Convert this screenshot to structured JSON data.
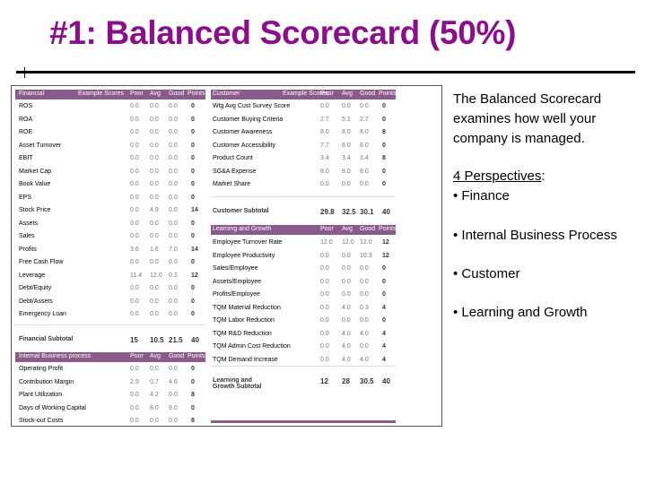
{
  "title": "#1: Balanced Scorecard (50%)",
  "colors": {
    "title": "#8b0e8b",
    "table_header": "#8a5a8a"
  },
  "scorecard": {
    "financial": {
      "header": [
        "Financial",
        "Example Scores",
        "Poor",
        "Avg",
        "Good",
        "Points"
      ],
      "rows": [
        [
          "ROS",
          "0.0",
          "0.0",
          "0.0",
          "0"
        ],
        [
          "ROA",
          "0.0",
          "0.0",
          "0.0",
          "0"
        ],
        [
          "ROE",
          "0.0",
          "0.0",
          "0.0",
          "0"
        ],
        [
          "Asset Turnover",
          "0.0",
          "0.0",
          "0.0",
          "0"
        ],
        [
          "EBIT",
          "0.0",
          "0.0",
          "0.0",
          "0"
        ],
        [
          "Market Cap",
          "0.0",
          "0.0",
          "0.0",
          "0"
        ],
        [
          "Book Value",
          "0.0",
          "0.0",
          "0.0",
          "0"
        ],
        [
          "EPS",
          "0.0",
          "0.0",
          "0.0",
          "0"
        ],
        [
          "Stock Price",
          "0.0",
          "4.9",
          "0.0",
          "14"
        ],
        [
          "Assets",
          "0.0",
          "0.0",
          "0.0",
          "0"
        ],
        [
          "Sales",
          "0.0",
          "0.0",
          "0.0",
          "0"
        ],
        [
          "Profits",
          "3.6",
          "1.6",
          "7.0",
          "14"
        ],
        [
          "Free Cash Flow",
          "0.0",
          "0.0",
          "0.0",
          "0"
        ],
        [
          "Leverage",
          "11.4",
          "12.0",
          "0.2",
          "12"
        ],
        [
          "Debt/Equity",
          "0.0",
          "0.0",
          "0.0",
          "0"
        ],
        [
          "Debt/Assets",
          "0.0",
          "0.0",
          "0.0",
          "0"
        ],
        [
          "Emergency Loan",
          "0.0",
          "0.0",
          "0.0",
          "0"
        ]
      ],
      "subtotal": [
        "Financial Subtotal",
        "15",
        "10.5",
        "21.5",
        "40"
      ]
    },
    "internal": {
      "header": [
        "Internal Business process",
        "",
        "Poor",
        "Avg",
        "Good",
        "Points"
      ],
      "rows": [
        [
          "Operating Profit",
          "0.0",
          "0.0",
          "0.0",
          "0"
        ],
        [
          "Contribution Margin",
          "2.9",
          "0.7",
          "4.6",
          "0"
        ],
        [
          "Plant Utilization",
          "0.0",
          "4.2",
          "0.0",
          "8"
        ],
        [
          "Days of Working Capital",
          "0.0",
          "8.0",
          "8.0",
          "0"
        ],
        [
          "Stock-out Costs",
          "0.0",
          "0.0",
          "0.0",
          "8"
        ]
      ]
    },
    "customer": {
      "header": [
        "Customer",
        "Example Scores",
        "Poor",
        "Avg",
        "Good",
        "Points"
      ],
      "rows": [
        [
          "Wtg Avg Cust Survey Score",
          "0.0",
          "0.0",
          "0.0",
          "0"
        ],
        [
          "Customer Buying Criteria",
          "2.7",
          "5.1",
          "2.7",
          "0"
        ],
        [
          "Customer Awareness",
          "8.0",
          "8.0",
          "8.0",
          "8"
        ],
        [
          "Customer Accessibility",
          "7.7",
          "8.0",
          "8.0",
          "0"
        ],
        [
          "Product Count",
          "3.4",
          "3.4",
          "3.4",
          "8"
        ],
        [
          "SG&A Expense",
          "8.0",
          "8.0",
          "8.0",
          "0"
        ],
        [
          "Market Share",
          "0.0",
          "0.0",
          "0.0",
          "0"
        ]
      ],
      "subtotal": [
        "Customer Subtotal",
        "29.8",
        "32.5",
        "30.1",
        "40"
      ]
    },
    "learning": {
      "header": [
        "Learning and Growth",
        "",
        "Poor",
        "Avg",
        "Good",
        "Points"
      ],
      "rows": [
        [
          "Employee Turnover Rate",
          "12.0",
          "12.0",
          "12.0",
          "12"
        ],
        [
          "Employee Productivity",
          "0.0",
          "0.0",
          "10.3",
          "12"
        ],
        [
          "Sales/Employee",
          "0.0",
          "0.0",
          "0.0",
          "0"
        ],
        [
          "Assets/Employee",
          "0.0",
          "0.0",
          "0.0",
          "0"
        ],
        [
          "Profits/Employee",
          "0.0",
          "0.0",
          "0.0",
          "0"
        ],
        [
          "TQM Material Reduction",
          "0.0",
          "4.0",
          "0.3",
          "4"
        ],
        [
          "TQM Labor Reduction",
          "0.0",
          "0.0",
          "0.0",
          "0"
        ],
        [
          "TQM R&D Reduction",
          "0.0",
          "4.0",
          "4.0",
          "4"
        ],
        [
          "TQM Admin Cost Reduction",
          "0.0",
          "4.0",
          "0.0",
          "4"
        ],
        [
          "TQM Demand Increase",
          "0.0",
          "4.0",
          "4.0",
          "4"
        ]
      ],
      "subtotal": [
        "Learning and Growth Subtotal",
        "12",
        "28",
        "30.5",
        "40"
      ]
    }
  },
  "side": {
    "intro": "The Balanced Scorecard examines how well your company is managed.",
    "perspectives_label": "4 Perspectives",
    "colon": ":",
    "items": [
      "• Finance",
      "• Internal Business Process",
      "• Customer",
      "• Learning and Growth"
    ]
  }
}
